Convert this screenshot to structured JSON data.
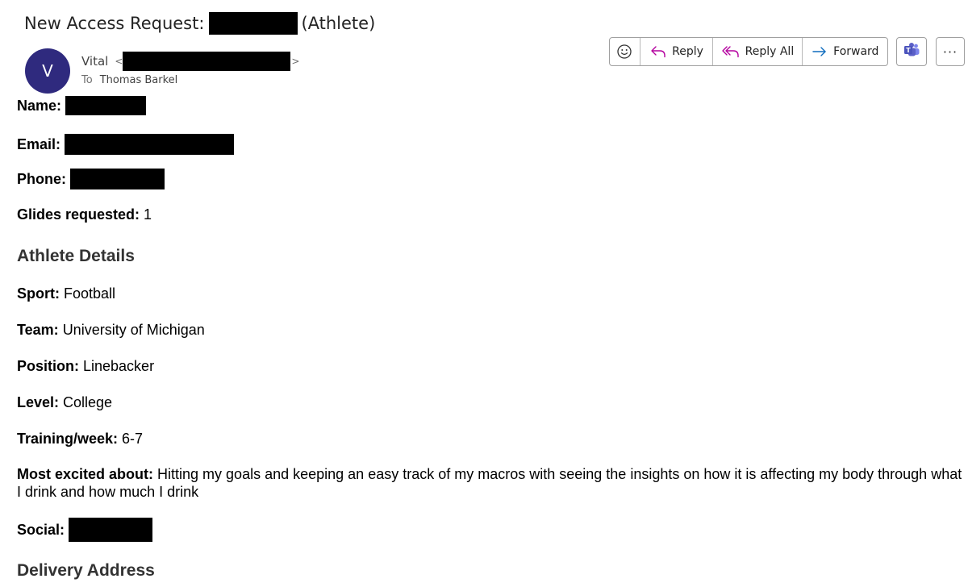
{
  "email": {
    "subject_prefix": "New Access Request:",
    "subject_suffix": "(Athlete)",
    "sender_initial": "V",
    "sender_name": "Vital",
    "sender_email_open": "<",
    "sender_email_close": ">",
    "to_label": "To",
    "to_name": "Thomas Barkel"
  },
  "actions": {
    "emoji_icon": "smiley-icon",
    "reply_label": "Reply",
    "reply_all_label": "Reply All",
    "forward_label": "Forward",
    "teams_icon": "teams-icon",
    "more_label": "···",
    "colors": {
      "reply_icon": "#b4009e",
      "forward_icon": "#0f6cbd",
      "teams_icon": "#5b5fc7"
    }
  },
  "fields": {
    "name_label": "Name:",
    "email_label": "Email:",
    "phone_label": "Phone:",
    "glides_label": "Glides requested:",
    "glides_value": "1"
  },
  "athlete": {
    "heading": "Athlete Details",
    "sport_label": "Sport:",
    "sport_value": "Football",
    "team_label": "Team:",
    "team_value": "University of Michigan",
    "position_label": "Position:",
    "position_value": "Linebacker",
    "level_label": "Level:",
    "level_value": "College",
    "training_label": "Training/week:",
    "training_value": "6-7",
    "excited_label": "Most excited about:",
    "excited_value": "Hitting my goals and keeping an easy track of my macros with seeing the insights on how it is affecting my body through what I drink and how much I drink",
    "social_label": "Social:"
  },
  "delivery": {
    "heading": "Delivery Address"
  },
  "colors": {
    "avatar_bg": "#2f2a7e",
    "redaction": "#000000"
  }
}
